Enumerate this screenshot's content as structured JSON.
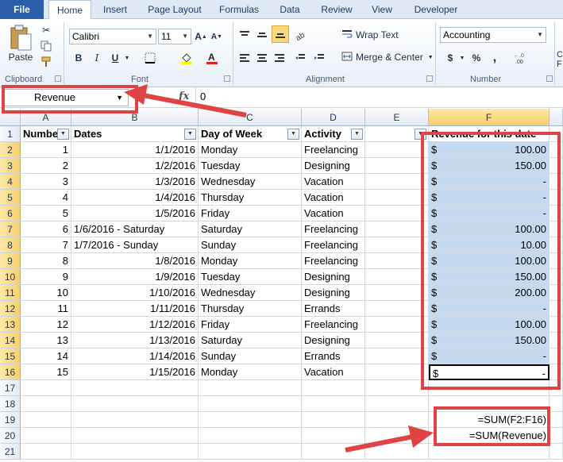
{
  "tabs": [
    "File",
    "Home",
    "Insert",
    "Page Layout",
    "Formulas",
    "Data",
    "Review",
    "View",
    "Developer"
  ],
  "ribbon": {
    "clipboard": {
      "label": "Clipboard",
      "paste": "Paste"
    },
    "font": {
      "label": "Font",
      "family": "Calibri",
      "size": "11",
      "bold": "B",
      "italic": "I",
      "underline": "U"
    },
    "alignment": {
      "label": "Alignment",
      "wrap_text": "Wrap Text",
      "merge_center": "Merge & Center"
    },
    "number": {
      "label": "Number",
      "format": "Accounting",
      "currency": "$",
      "percent": "%",
      "comma": ","
    },
    "styles": {
      "partial": "C F"
    }
  },
  "formula_bar": {
    "name_box": "Revenue",
    "fx": "fx",
    "value": "0"
  },
  "columns": [
    "A",
    "B",
    "C",
    "D",
    "E",
    "F"
  ],
  "rows": [
    "1",
    "2",
    "3",
    "4",
    "5",
    "6",
    "7",
    "8",
    "9",
    "10",
    "11",
    "12",
    "13",
    "14",
    "15",
    "16",
    "17",
    "18",
    "19",
    "20",
    "21"
  ],
  "headers": {
    "a": "Number",
    "b": "Dates",
    "c": "Day of Week",
    "d": "Activity",
    "e": "",
    "f": "Revenue for this date"
  },
  "data_rows": [
    {
      "a": "1",
      "b": "1/1/2016",
      "c": "Monday",
      "d": "Freelancing",
      "cur": "$",
      "f": "100.00"
    },
    {
      "a": "2",
      "b": "1/2/2016",
      "c": "Tuesday",
      "d": "Designing",
      "cur": "$",
      "f": "150.00"
    },
    {
      "a": "3",
      "b": "1/3/2016",
      "c": "Wednesday",
      "d": "Vacation",
      "cur": "$",
      "f": "-"
    },
    {
      "a": "4",
      "b": "1/4/2016",
      "c": "Thursday",
      "d": "Vacation",
      "cur": "$",
      "f": "-"
    },
    {
      "a": "5",
      "b": "1/5/2016",
      "c": "Friday",
      "d": "Vacation",
      "cur": "$",
      "f": "-"
    },
    {
      "a": "6",
      "b": "1/6/2016 - Saturday",
      "c": "Saturday",
      "d": "Freelancing",
      "cur": "$",
      "f": "100.00"
    },
    {
      "a": "7",
      "b": "1/7/2016 - Sunday",
      "c": "Sunday",
      "d": "Freelancing",
      "cur": "$",
      "f": "10.00"
    },
    {
      "a": "8",
      "b": "1/8/2016",
      "c": "Monday",
      "d": "Freelancing",
      "cur": "$",
      "f": "100.00"
    },
    {
      "a": "9",
      "b": "1/9/2016",
      "c": "Tuesday",
      "d": "Designing",
      "cur": "$",
      "f": "150.00"
    },
    {
      "a": "10",
      "b": "1/10/2016",
      "c": "Wednesday",
      "d": "Designing",
      "cur": "$",
      "f": "200.00"
    },
    {
      "a": "11",
      "b": "1/11/2016",
      "c": "Thursday",
      "d": "Errands",
      "cur": "$",
      "f": "-"
    },
    {
      "a": "12",
      "b": "1/12/2016",
      "c": "Friday",
      "d": "Freelancing",
      "cur": "$",
      "f": "100.00"
    },
    {
      "a": "13",
      "b": "1/13/2016",
      "c": "Saturday",
      "d": "Designing",
      "cur": "$",
      "f": "150.00"
    },
    {
      "a": "14",
      "b": "1/14/2016",
      "c": "Sunday",
      "d": "Errands",
      "cur": "$",
      "f": "-"
    },
    {
      "a": "15",
      "b": "1/15/2016",
      "c": "Monday",
      "d": "Vacation",
      "cur": "$",
      "f": "-"
    }
  ],
  "formulas": {
    "row19": "=SUM(F2:F16)",
    "row20": "=SUM(Revenue)"
  },
  "colors": {
    "annotation": "#e04343",
    "selection": "#c5d9f1",
    "file_tab": "#2a5ea8"
  }
}
